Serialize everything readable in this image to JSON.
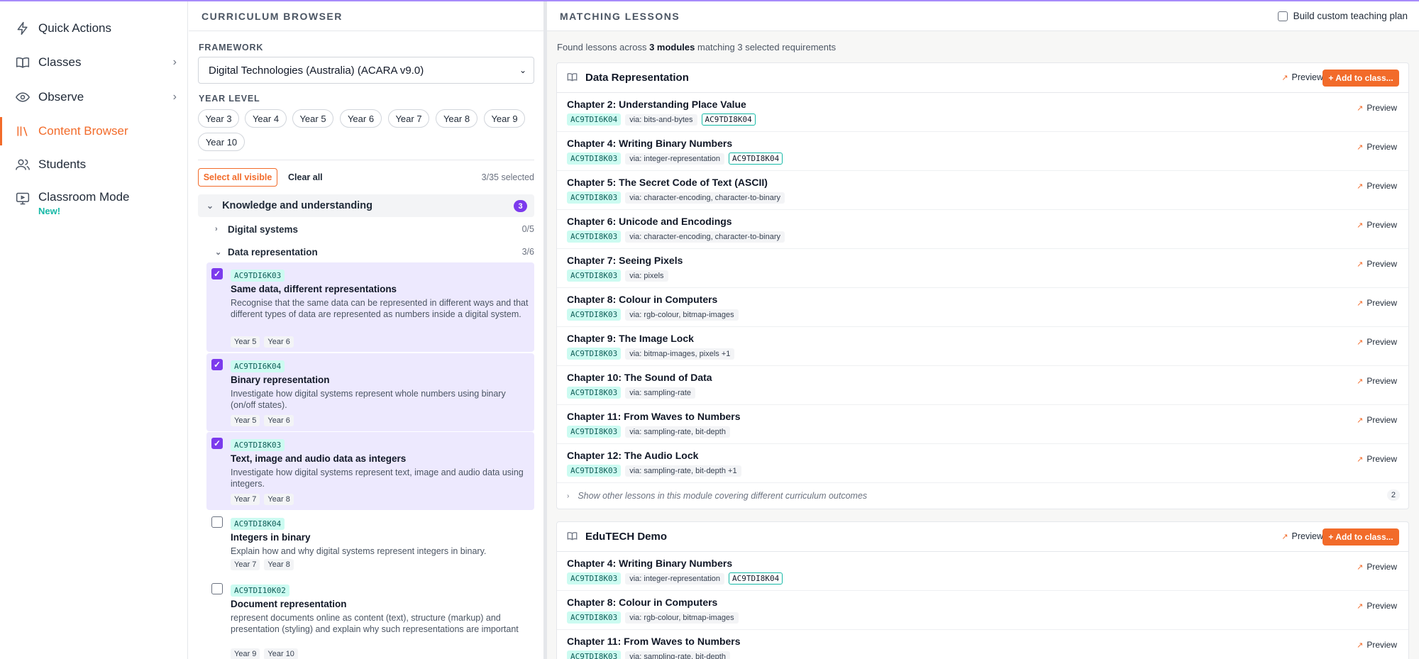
{
  "sidebar": {
    "items": [
      {
        "label": "Quick Actions",
        "icon": "bolt-icon"
      },
      {
        "label": "Classes",
        "icon": "book-icon"
      },
      {
        "label": "Observe",
        "icon": "eye-icon"
      },
      {
        "label": "Content Browser",
        "icon": "library-icon"
      },
      {
        "label": "Students",
        "icon": "users-icon"
      },
      {
        "label": "Classroom Mode",
        "icon": "presentation-icon",
        "badge": "New!"
      }
    ]
  },
  "browser": {
    "title": "CURRICULUM BROWSER",
    "framework_label": "FRAMEWORK",
    "framework_value": "Digital Technologies (Australia) (ACARA v9.0)",
    "year_level_label": "YEAR LEVEL",
    "years": [
      "Year 3",
      "Year 4",
      "Year 5",
      "Year 6",
      "Year 7",
      "Year 8",
      "Year 9",
      "Year 10"
    ],
    "select_all": "Select all visible",
    "clear_all": "Clear all",
    "selected_count": "3/35 selected",
    "group": {
      "label": "Knowledge and understanding",
      "badge": "3"
    },
    "subgroups": [
      {
        "label": "Digital systems",
        "count": "0/5"
      },
      {
        "label": "Data representation",
        "count": "3/6"
      }
    ],
    "items": [
      {
        "code": "AC9TDI6K03",
        "title": "Same data, different representations",
        "desc": "Recognise that the same data can be represented in different ways and that different types of data are represented as numbers inside a digital system.",
        "years": [
          "Year 5",
          "Year 6"
        ],
        "checked": true
      },
      {
        "code": "AC9TDI6K04",
        "title": "Binary representation",
        "desc": "Investigate how digital systems represent whole numbers using binary (on/off states).",
        "years": [
          "Year 5",
          "Year 6"
        ],
        "checked": true
      },
      {
        "code": "AC9TDI8K03",
        "title": "Text, image and audio data as integers",
        "desc": "Investigate how digital systems represent text, image and audio data using integers.",
        "years": [
          "Year 7",
          "Year 8"
        ],
        "checked": true
      },
      {
        "code": "AC9TDI8K04",
        "title": "Integers in binary",
        "desc": "Explain how and why digital systems represent integers in binary.",
        "years": [
          "Year 7",
          "Year 8"
        ],
        "checked": false
      },
      {
        "code": "AC9TDI10K02",
        "title": "Document representation",
        "desc": "represent documents online as content (text), structure (markup) and presentation (styling) and explain why such representations are important",
        "years": [
          "Year 9",
          "Year 10"
        ],
        "checked": false
      }
    ]
  },
  "lessons": {
    "title": "MATCHING LESSONS",
    "custom_plan": "Build custom teaching plan",
    "found_prefix": "Found lessons across ",
    "found_bold": "3 modules",
    "found_suffix": " matching 3 selected requirements",
    "preview_label": "Preview",
    "add_label": "+ Add to class...",
    "modules": [
      {
        "title": "Data Representation",
        "lessons": [
          {
            "title": "Chapter 2: Understanding Place Value",
            "code": "AC9TDI6K04",
            "via": "via: bits-and-bytes",
            "extra": "AC9TDI8K04"
          },
          {
            "title": "Chapter 4: Writing Binary Numbers",
            "code": "AC9TDI8K03",
            "via": "via: integer-representation",
            "extra": "AC9TDI8K04"
          },
          {
            "title": "Chapter 5: The Secret Code of Text (ASCII)",
            "code": "AC9TDI8K03",
            "via": "via: character-encoding, character-to-binary",
            "extra": ""
          },
          {
            "title": "Chapter 6: Unicode and Encodings",
            "code": "AC9TDI8K03",
            "via": "via: character-encoding, character-to-binary",
            "extra": ""
          },
          {
            "title": "Chapter 7: Seeing Pixels",
            "code": "AC9TDI8K03",
            "via": "via: pixels",
            "extra": ""
          },
          {
            "title": "Chapter 8: Colour in Computers",
            "code": "AC9TDI8K03",
            "via": "via: rgb-colour, bitmap-images",
            "extra": ""
          },
          {
            "title": "Chapter 9: The Image Lock",
            "code": "AC9TDI8K03",
            "via": "via: bitmap-images, pixels +1",
            "extra": ""
          },
          {
            "title": "Chapter 10: The Sound of Data",
            "code": "AC9TDI8K03",
            "via": "via: sampling-rate",
            "extra": ""
          },
          {
            "title": "Chapter 11: From Waves to Numbers",
            "code": "AC9TDI8K03",
            "via": "via: sampling-rate, bit-depth",
            "extra": ""
          },
          {
            "title": "Chapter 12: The Audio Lock",
            "code": "AC9TDI8K03",
            "via": "via: sampling-rate, bit-depth +1",
            "extra": ""
          }
        ],
        "show_other": "Show other lessons in this module covering different curriculum outcomes",
        "show_other_count": "2"
      },
      {
        "title": "EduTECH Demo",
        "lessons": [
          {
            "title": "Chapter 4: Writing Binary Numbers",
            "code": "AC9TDI8K03",
            "via": "via: integer-representation",
            "extra": "AC9TDI8K04"
          },
          {
            "title": "Chapter 8: Colour in Computers",
            "code": "AC9TDI8K03",
            "via": "via: rgb-colour, bitmap-images",
            "extra": ""
          },
          {
            "title": "Chapter 11: From Waves to Numbers",
            "code": "AC9TDI8K03",
            "via": "via: sampling-rate, bit-depth",
            "extra": ""
          }
        ]
      }
    ]
  },
  "colors": {
    "accent": "#f26b2a",
    "purple": "#7c3aed",
    "teal": "#14b8a6"
  }
}
